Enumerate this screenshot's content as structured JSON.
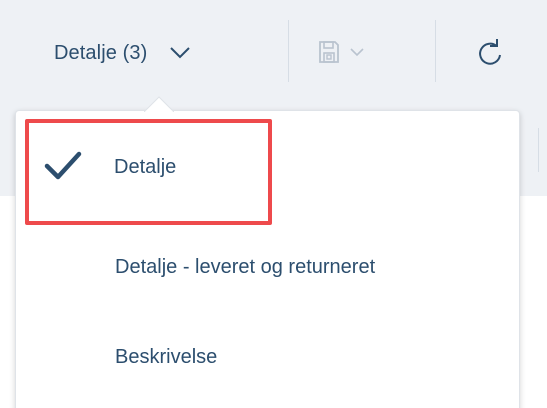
{
  "toolbar": {
    "view_selector": {
      "label": "Detalje (3)",
      "chevron_icon": "chevron-down-icon"
    },
    "save_button": {
      "icon": "floppy-disk-icon",
      "chevron_icon": "chevron-down-icon",
      "disabled": true
    },
    "refresh_button": {
      "icon": "refresh-icon"
    }
  },
  "view_menu": {
    "items": [
      {
        "label": "Detalje",
        "selected": true,
        "icon": "checkmark-icon"
      },
      {
        "label": "Detalje - leveret og returneret",
        "selected": false
      },
      {
        "label": "Beskrivelse",
        "selected": false
      }
    ]
  },
  "colors": {
    "toolbar_bg": "#eef1f5",
    "text": "#2c4e6e",
    "disabled_icon": "#b9c3cf",
    "highlight": "#ee4a4c"
  }
}
